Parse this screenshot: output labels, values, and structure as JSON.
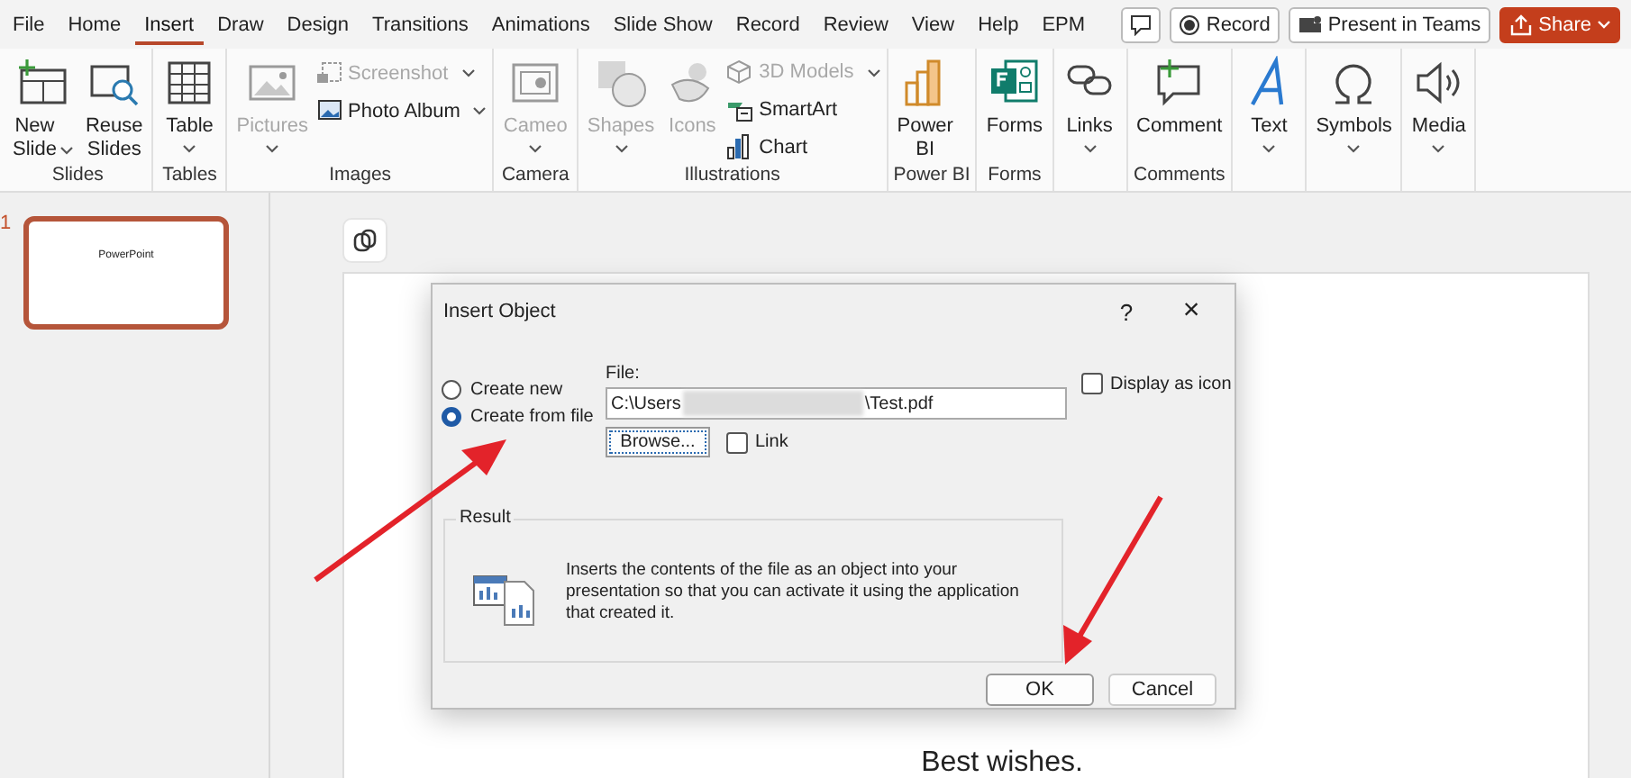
{
  "tabs": [
    {
      "label": "File",
      "selected": false
    },
    {
      "label": "Home",
      "selected": false
    },
    {
      "label": "Insert",
      "selected": true
    },
    {
      "label": "Draw",
      "selected": false
    },
    {
      "label": "Design",
      "selected": false
    },
    {
      "label": "Transitions",
      "selected": false
    },
    {
      "label": "Animations",
      "selected": false
    },
    {
      "label": "Slide Show",
      "selected": false
    },
    {
      "label": "Record",
      "selected": false
    },
    {
      "label": "Review",
      "selected": false
    },
    {
      "label": "View",
      "selected": false
    },
    {
      "label": "Help",
      "selected": false
    },
    {
      "label": "EPM",
      "selected": false
    }
  ],
  "title_buttons": [
    {
      "kind": "comments"
    },
    {
      "kind": "record",
      "label": "Record"
    },
    {
      "kind": "teams",
      "label": "Present in Teams"
    },
    {
      "kind": "share",
      "label": "Share"
    }
  ],
  "ribbon": {
    "groups": [
      {
        "label": "Slides",
        "commands": [
          {
            "label": "New Slide",
            "kind": "large",
            "dropdown": true,
            "disabled": false
          },
          {
            "label": "Reuse Slides",
            "kind": "large",
            "dropdown": false,
            "disabled": false
          }
        ]
      },
      {
        "label": "Tables",
        "commands": [
          {
            "label": "Table",
            "kind": "large",
            "dropdown": true,
            "disabled": false
          }
        ]
      },
      {
        "label": "Images",
        "commands": [
          {
            "label": "Pictures",
            "kind": "large",
            "dropdown": true,
            "disabled": true
          },
          {
            "label": "Screenshot",
            "kind": "small",
            "dropdown": true,
            "disabled": true
          },
          {
            "label": "Photo Album",
            "kind": "small",
            "dropdown": true,
            "disabled": false
          }
        ]
      },
      {
        "label": "Camera",
        "commands": [
          {
            "label": "Cameo",
            "kind": "large",
            "dropdown": true,
            "disabled": true
          }
        ]
      },
      {
        "label": "Illustrations",
        "commands": [
          {
            "label": "Shapes",
            "kind": "large",
            "dropdown": true,
            "disabled": true
          },
          {
            "label": "Icons",
            "kind": "large",
            "dropdown": false,
            "disabled": true
          },
          {
            "label": "3D Models",
            "kind": "small",
            "dropdown": true,
            "disabled": true
          },
          {
            "label": "SmartArt",
            "kind": "small",
            "dropdown": false,
            "disabled": false
          },
          {
            "label": "Chart",
            "kind": "small",
            "dropdown": false,
            "disabled": false
          }
        ]
      },
      {
        "label": "Power BI",
        "commands": [
          {
            "label": "Power BI",
            "kind": "large",
            "dropdown": false,
            "disabled": false
          }
        ]
      },
      {
        "label": "Forms",
        "commands": [
          {
            "label": "Forms",
            "kind": "large",
            "dropdown": false,
            "disabled": false
          }
        ]
      },
      {
        "commands": [
          {
            "label": "Links",
            "kind": "large",
            "dropdown": true,
            "disabled": false
          }
        ]
      },
      {
        "label": "Comments",
        "commands": [
          {
            "label": "Comment",
            "kind": "large",
            "dropdown": false,
            "disabled": false
          }
        ]
      },
      {
        "commands": [
          {
            "label": "Text",
            "kind": "large",
            "dropdown": true,
            "disabled": false
          }
        ]
      },
      {
        "commands": [
          {
            "label": "Symbols",
            "kind": "large",
            "dropdown": true,
            "disabled": false
          }
        ]
      },
      {
        "commands": [
          {
            "label": "Media",
            "kind": "large",
            "dropdown": true,
            "disabled": false
          }
        ]
      }
    ]
  },
  "thumbnails": [
    {
      "number": "1",
      "title": "PowerPoint",
      "selected": true
    }
  ],
  "slide": {
    "text": "Best wishes."
  },
  "dialog": {
    "title": "Insert Object",
    "help": "?",
    "close": "×",
    "options": [
      {
        "label": "Create new",
        "selected": false
      },
      {
        "label": "Create from file",
        "selected": true
      }
    ],
    "file_label": "File:",
    "file_value_start": "C:\\Users",
    "file_value_end": "\\Test.pdf",
    "browse": "Browse...",
    "link": {
      "label": "Link",
      "checked": false
    },
    "display_as_icon": {
      "label": "Display as icon",
      "checked": false
    },
    "result": {
      "title": "Result",
      "text": "Inserts the contents of the file as an object into your presentation so that you can activate it using the application that created it."
    },
    "buttons": [
      {
        "label": "OK",
        "default": true
      },
      {
        "label": "Cancel",
        "default": false
      }
    ]
  }
}
